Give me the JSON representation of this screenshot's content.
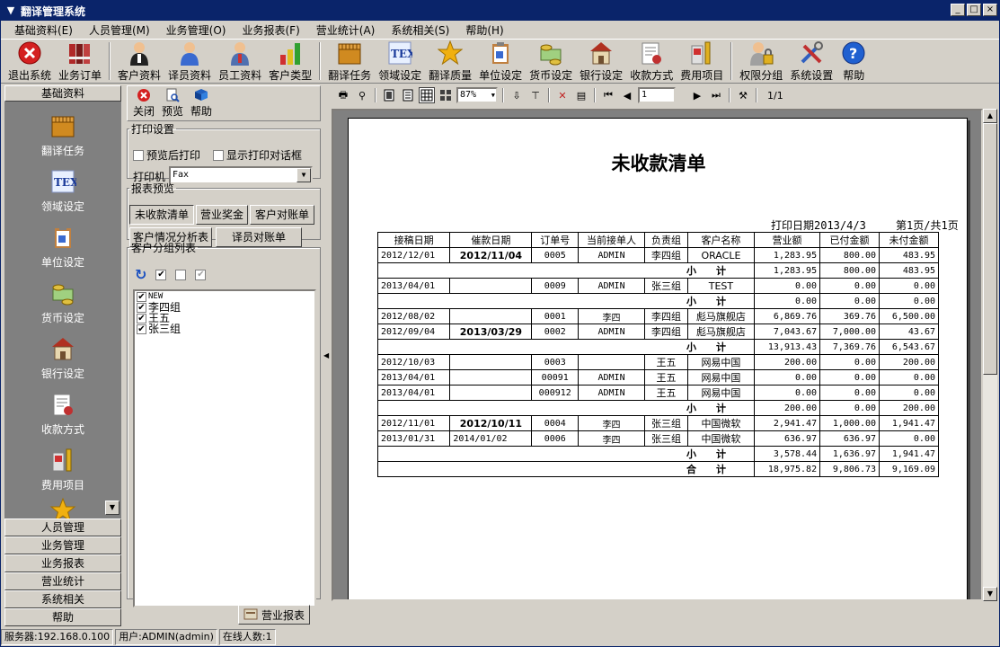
{
  "window": {
    "title": "翻译管理系统"
  },
  "menubar": [
    "基础资料(E)",
    "人员管理(M)",
    "业务管理(O)",
    "业务报表(F)",
    "营业统计(A)",
    "系统相关(S)",
    "帮助(H)"
  ],
  "toolbar": [
    {
      "label": "退出系统",
      "icon": "exit-icon"
    },
    {
      "label": "业务订单",
      "icon": "binders-icon"
    },
    {
      "label": "客户资料",
      "icon": "customer-icon"
    },
    {
      "label": "译员资料",
      "icon": "translator-icon"
    },
    {
      "label": "员工资料",
      "icon": "employee-icon"
    },
    {
      "label": "客户类型",
      "icon": "bar-chart-icon"
    },
    {
      "label": "翻译任务",
      "icon": "task-box-icon"
    },
    {
      "label": "领域设定",
      "icon": "tex-icon"
    },
    {
      "label": "翻译质量",
      "icon": "star-icon"
    },
    {
      "label": "单位设定",
      "icon": "clipboard-icon"
    },
    {
      "label": "货币设定",
      "icon": "money-icon"
    },
    {
      "label": "银行设定",
      "icon": "bank-icon"
    },
    {
      "label": "收款方式",
      "icon": "receipt-icon"
    },
    {
      "label": "费用项目",
      "icon": "ruler-icon"
    },
    {
      "label": "权限分组",
      "icon": "lock-user-icon"
    },
    {
      "label": "系统设置",
      "icon": "tools-icon"
    },
    {
      "label": "帮助",
      "icon": "help-icon"
    }
  ],
  "leftpane": {
    "header": "基础资料",
    "items": [
      {
        "label": "翻译任务",
        "icon": "task-box-icon"
      },
      {
        "label": "领域设定",
        "icon": "tex-icon"
      },
      {
        "label": "单位设定",
        "icon": "clipboard-icon"
      },
      {
        "label": "货币设定",
        "icon": "money-icon"
      },
      {
        "label": "银行设定",
        "icon": "bank-icon"
      },
      {
        "label": "收款方式",
        "icon": "receipt-icon"
      },
      {
        "label": "费用项目",
        "icon": "ruler-icon"
      }
    ],
    "tabs": [
      "人员管理",
      "业务管理",
      "业务报表",
      "营业统计",
      "系统相关",
      "帮助"
    ]
  },
  "midpane": {
    "tools": [
      {
        "label": "关闭",
        "icon": "close-icon"
      },
      {
        "label": "预览",
        "icon": "preview-icon"
      },
      {
        "label": "帮助",
        "icon": "help-book-icon"
      }
    ],
    "print_group": {
      "legend": "打印设置",
      "preview_after_print": "预览后打印",
      "show_print_dialog": "显示打印对话框",
      "printer_label": "打印机",
      "printer_value": "Fax"
    },
    "report_group": {
      "legend": "报表预览",
      "buttons": [
        "未收款清单",
        "营业奖金",
        "客户对账单",
        "客户情况分析表",
        "译员对账单"
      ]
    },
    "customer_group": {
      "legend": "客户分组列表",
      "items": [
        "NEW",
        "李四组",
        "王五",
        "张三组"
      ]
    }
  },
  "preview": {
    "zoom": "87%",
    "page_input": "1",
    "page_count": "1/1"
  },
  "report": {
    "title": "未收款清单",
    "print_date": "打印日期2013/4/3",
    "page_info": "第1页/共1页",
    "headers": [
      "接稿日期",
      "催款日期",
      "订单号",
      "当前接单人",
      "负责组",
      "客户名称",
      "营业额",
      "已付金额",
      "未付金额"
    ],
    "rows": [
      {
        "type": "data",
        "cells": [
          "2012/12/01",
          "2012/11/04",
          "0005",
          "ADMIN",
          "李四组",
          "ORACLE",
          "1,283.95",
          "800.00",
          "483.95"
        ],
        "bold2": true
      },
      {
        "type": "sub",
        "label": "小　　计",
        "values": [
          "1,283.95",
          "800.00",
          "483.95"
        ]
      },
      {
        "type": "data",
        "cells": [
          "2013/04/01",
          "",
          "0009",
          "ADMIN",
          "张三组",
          "TEST",
          "0.00",
          "0.00",
          "0.00"
        ]
      },
      {
        "type": "sub",
        "label": "小　　计",
        "values": [
          "0.00",
          "0.00",
          "0.00"
        ]
      },
      {
        "type": "data",
        "cells": [
          "2012/08/02",
          "",
          "0001",
          "李四",
          "李四组",
          "彪马旗舰店",
          "6,869.76",
          "369.76",
          "6,500.00"
        ]
      },
      {
        "type": "data",
        "cells": [
          "2012/09/04",
          "2013/03/29",
          "0002",
          "ADMIN",
          "李四组",
          "彪马旗舰店",
          "7,043.67",
          "7,000.00",
          "43.67"
        ],
        "bold2": true
      },
      {
        "type": "sub",
        "label": "小　　计",
        "values": [
          "13,913.43",
          "7,369.76",
          "6,543.67"
        ]
      },
      {
        "type": "data",
        "cells": [
          "2012/10/03",
          "",
          "0003",
          "",
          "王五",
          "网易中国",
          "200.00",
          "0.00",
          "200.00"
        ]
      },
      {
        "type": "data",
        "cells": [
          "2013/04/01",
          "",
          "00091",
          "ADMIN",
          "王五",
          "网易中国",
          "0.00",
          "0.00",
          "0.00"
        ]
      },
      {
        "type": "data",
        "cells": [
          "2013/04/01",
          "",
          "000912",
          "ADMIN",
          "王五",
          "网易中国",
          "0.00",
          "0.00",
          "0.00"
        ]
      },
      {
        "type": "sub",
        "label": "小　　计",
        "values": [
          "200.00",
          "0.00",
          "200.00"
        ]
      },
      {
        "type": "data",
        "cells": [
          "2012/11/01",
          "2012/10/11",
          "0004",
          "李四",
          "张三组",
          "中国微软",
          "2,941.47",
          "1,000.00",
          "1,941.47"
        ],
        "bold2": true
      },
      {
        "type": "data",
        "cells": [
          "2013/01/31",
          "2014/01/02",
          "0006",
          "李四",
          "张三组",
          "中国微软",
          "636.97",
          "636.97",
          "0.00"
        ]
      },
      {
        "type": "sub",
        "label": "小　　计",
        "values": [
          "3,578.44",
          "1,636.97",
          "1,941.47"
        ]
      },
      {
        "type": "sub",
        "label": "合　　计",
        "values": [
          "18,975.82",
          "9,806.73",
          "9,169.09"
        ]
      }
    ]
  },
  "bottom_tab": {
    "label": "营业报表",
    "icon": "report-icon"
  },
  "statusbar": [
    "服务器:192.168.0.100",
    "用户:ADMIN(admin)",
    "在线人数:1"
  ]
}
